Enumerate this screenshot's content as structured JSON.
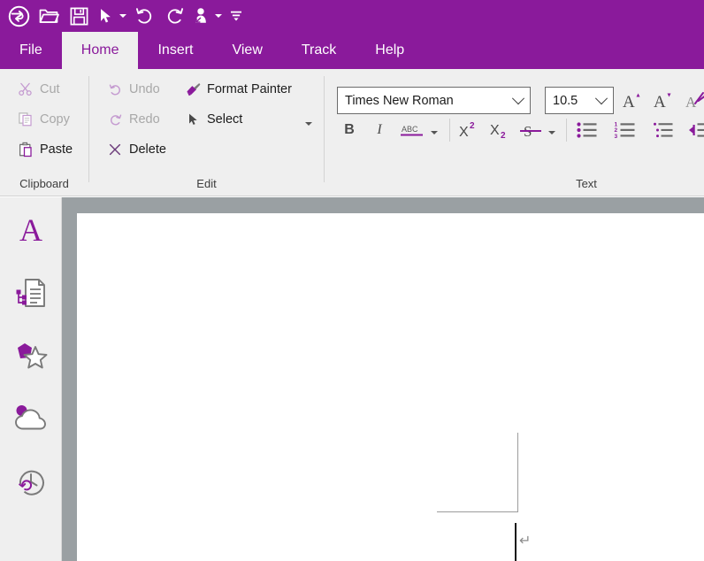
{
  "app": {
    "accent_color": "#8a1a9b",
    "ribbon_bg": "#efefef",
    "canvas_bg": "#9aa0a3"
  },
  "quick_access": {
    "items": [
      {
        "name": "app-logo-icon",
        "label": "Application logo"
      },
      {
        "name": "open-icon",
        "label": "Open"
      },
      {
        "name": "save-icon",
        "label": "Save"
      },
      {
        "name": "select-cursor-icon",
        "label": "Select"
      },
      {
        "name": "undo-icon",
        "label": "Undo"
      },
      {
        "name": "redo-icon",
        "label": "Redo"
      },
      {
        "name": "touch-mode-icon",
        "label": "Touch/Mouse Mode"
      },
      {
        "name": "customize-toolbar-icon",
        "label": "Customize Quick Access Toolbar"
      }
    ]
  },
  "tabs": [
    {
      "label": "File",
      "active": false
    },
    {
      "label": "Home",
      "active": true
    },
    {
      "label": "Insert",
      "active": false
    },
    {
      "label": "View",
      "active": false
    },
    {
      "label": "Track",
      "active": false
    },
    {
      "label": "Help",
      "active": false
    }
  ],
  "ribbon": {
    "groups": [
      {
        "id": "clipboard",
        "label": "Clipboard",
        "items": [
          {
            "label": "Cut",
            "icon": "scissors-icon",
            "disabled": true
          },
          {
            "label": "Copy",
            "icon": "copy-icon",
            "disabled": true
          },
          {
            "label": "Paste",
            "icon": "paste-icon",
            "disabled": false
          }
        ]
      },
      {
        "id": "edit",
        "label": "Edit",
        "items": [
          {
            "label": "Undo",
            "icon": "undo-arrow-icon",
            "disabled": true
          },
          {
            "label": "Redo",
            "icon": "redo-arrow-icon",
            "disabled": true
          },
          {
            "label": "Delete",
            "icon": "delete-x-icon",
            "disabled": false
          },
          {
            "label": "Format Painter",
            "icon": "format-painter-icon",
            "disabled": false
          },
          {
            "label": "Select",
            "icon": "select-arrow-icon",
            "disabled": false,
            "has_dropdown": true
          }
        ]
      },
      {
        "id": "text",
        "label": "Text",
        "font_name": "Times New Roman",
        "font_size": "10.5",
        "buttons": [
          {
            "name": "grow-font-icon",
            "label": "Grow Font"
          },
          {
            "name": "shrink-font-icon",
            "label": "Shrink Font"
          },
          {
            "name": "clear-formatting-icon",
            "label": "Clear Formatting"
          },
          {
            "name": "bold-icon",
            "label": "B"
          },
          {
            "name": "italic-icon",
            "label": "I"
          },
          {
            "name": "underline-icon",
            "label": "ABC"
          },
          {
            "name": "superscript-icon",
            "label": "X2"
          },
          {
            "name": "subscript-icon",
            "label": "X2"
          },
          {
            "name": "strikethrough-icon",
            "label": "S"
          },
          {
            "name": "bullet-list-icon",
            "label": "Bullets"
          },
          {
            "name": "numbered-list-icon",
            "label": "Numbering"
          },
          {
            "name": "multilevel-list-icon",
            "label": "Multilevel List"
          },
          {
            "name": "decrease-indent-icon",
            "label": "Decrease Indent"
          }
        ]
      }
    ]
  },
  "sidebar": {
    "items": [
      {
        "name": "sidebar-item-styles",
        "label": "Styles",
        "icon": "letter-a-icon"
      },
      {
        "name": "sidebar-item-outline",
        "label": "Document Outline",
        "icon": "document-outline-icon"
      },
      {
        "name": "sidebar-item-shapes",
        "label": "Shapes",
        "icon": "shapes-icon"
      },
      {
        "name": "sidebar-item-cloud",
        "label": "Cloud",
        "icon": "cloud-icon"
      },
      {
        "name": "sidebar-item-history",
        "label": "Version History",
        "icon": "clock-history-icon"
      }
    ]
  },
  "document": {
    "paragraph_mark": "↵",
    "content": ""
  }
}
